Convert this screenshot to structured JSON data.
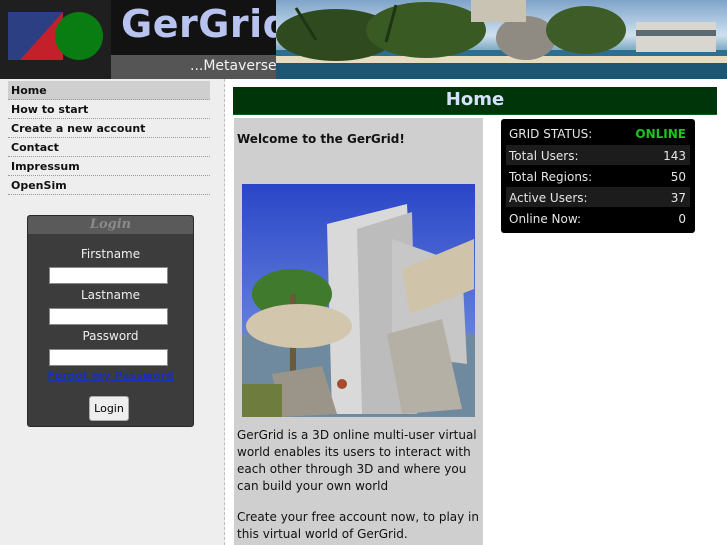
{
  "header": {
    "title": "GerGrid",
    "subtitle": "...Metaverse"
  },
  "nav": {
    "items": [
      {
        "label": "Home"
      },
      {
        "label": "How to start"
      },
      {
        "label": "Create a new account"
      },
      {
        "label": "Contact"
      },
      {
        "label": "Impressum"
      },
      {
        "label": "OpenSim"
      }
    ],
    "active": "Home"
  },
  "login": {
    "heading": "Login",
    "firstname_label": "Firstname",
    "lastname_label": "Lastname",
    "password_label": "Password",
    "firstname_value": "",
    "lastname_value": "",
    "password_value": "",
    "forgot_link": "Forgot my Password",
    "button": "Login"
  },
  "page": {
    "title": "Home",
    "welcome": "Welcome to the GerGrid!",
    "paragraph1": "GerGrid is a 3D online multi-user virtual world enables its users to interact with each other through 3D and where you can build your own world",
    "paragraph2": "Create your free account now, to play in this virtual world of GerGrid."
  },
  "grid_status": {
    "heading": "GRID STATUS:",
    "status": "ONLINE",
    "rows": [
      {
        "label": "Total Users:",
        "value": "143"
      },
      {
        "label": "Total Regions:",
        "value": "50"
      },
      {
        "label": "Active Users:",
        "value": "37"
      },
      {
        "label": "Online Now:",
        "value": "0"
      }
    ]
  },
  "colors": {
    "accent_green": "#00350a",
    "online": "#1ec51e",
    "link": "#1a2fb5"
  }
}
